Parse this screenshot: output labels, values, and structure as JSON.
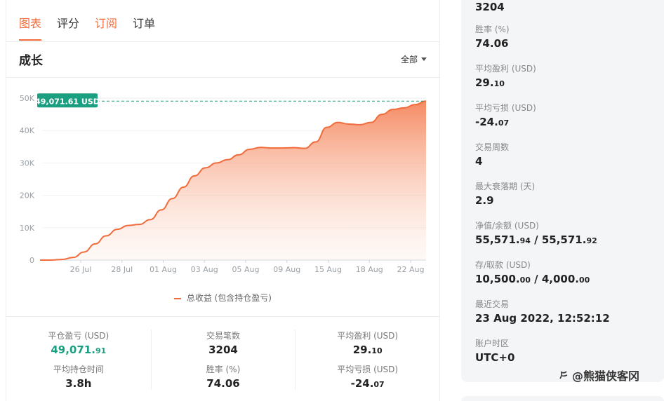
{
  "tabs": [
    "图表",
    "评分",
    "订阅",
    "订单"
  ],
  "chart_title": "成长",
  "range_select": "全部",
  "current_badge": "49,071.61 USD",
  "legend_label": "总收益 (包含持仓盈亏)",
  "chart_data": {
    "type": "area",
    "title": "成长",
    "y_ticks": [
      "0",
      "10K",
      "20K",
      "30K",
      "40K",
      "50K"
    ],
    "x_ticks": [
      "26 Jul",
      "28 Jul",
      "01 Aug",
      "03 Aug",
      "05 Aug",
      "09 Aug",
      "15 Aug",
      "18 Aug",
      "22 Aug"
    ],
    "ylim": [
      0,
      50000
    ],
    "series": [
      {
        "name": "总收益 (包含持仓盈亏)",
        "values": [
          0,
          0,
          200,
          800,
          2500,
          5000,
          7500,
          9500,
          10700,
          11000,
          12500,
          15500,
          19000,
          22500,
          26000,
          28500,
          30000,
          31000,
          32500,
          34200,
          34800,
          34600,
          34600,
          34700,
          34500,
          36500,
          41000,
          42500,
          42000,
          41800,
          42500,
          45000,
          46500,
          47000,
          48000,
          49071.61
        ]
      }
    ],
    "grid": true,
    "line_color": "#f26b3a"
  },
  "stats": {
    "col1": [
      {
        "label": "平仓盈亏 (USD)",
        "int": "49,071.",
        "dec": "91",
        "style": "green"
      },
      {
        "label": "平均持仓时间",
        "int": "3.8h",
        "dec": ""
      }
    ],
    "col2": [
      {
        "label": "交易笔数",
        "int": "3204",
        "dec": ""
      },
      {
        "label": "胜率 (%)",
        "int": "74.06",
        "dec": ""
      }
    ],
    "col3": [
      {
        "label": "平均盈利 (USD)",
        "int": "29.",
        "dec": "10"
      },
      {
        "label": "平均亏损 (USD)",
        "int": "-24.",
        "dec": "07"
      }
    ]
  },
  "right_panel": {
    "first_value": "3204",
    "items": [
      {
        "label": "胜率 (%)",
        "int": "74.06",
        "dec": ""
      },
      {
        "label": "平均盈利 (USD)",
        "int": "29.",
        "dec": "10"
      },
      {
        "label": "平均亏损 (USD)",
        "int": "-24.",
        "dec": "07"
      },
      {
        "label": "交易周数",
        "int": "4",
        "dec": ""
      },
      {
        "label": "最大衰落期 (天)",
        "int": "2.9",
        "dec": ""
      },
      {
        "label": "净值/余额 (USD)",
        "int": "55,571.",
        "dec": "94",
        "int2": "55,571.",
        "dec2": "92"
      },
      {
        "label": "存/取款 (USD)",
        "int": "10,500.",
        "dec": "00",
        "int2": "4,000.",
        "dec2": "00"
      },
      {
        "label": "最近交易",
        "int": "23 Aug 2022, 12:52:12",
        "dec": ""
      },
      {
        "label": "账户时区",
        "int": "UTC+0",
        "dec": ""
      }
    ]
  },
  "watermark": "@熊猫侠客冈"
}
